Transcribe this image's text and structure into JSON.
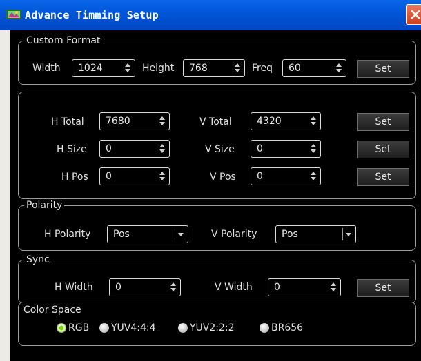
{
  "window": {
    "title": "Advance Timming Setup",
    "colors": {
      "titlebar": "#0055d6",
      "panel_bg": "#000000",
      "text": "#e0e0e0",
      "close": "#d9532c"
    }
  },
  "custom_format": {
    "legend": "Custom Format",
    "width_label": "Width",
    "width_value": "1024",
    "height_label": "Height",
    "height_value": "768",
    "freq_label": "Freq",
    "freq_value": "60",
    "set_label": "Set"
  },
  "totals": {
    "h_total_label": "H Total",
    "h_total_value": "7680",
    "v_total_label": "V Total",
    "v_total_value": "4320",
    "h_size_label": "H Size",
    "h_size_value": "0",
    "v_size_label": "V Size",
    "v_size_value": "0",
    "h_pos_label": "H Pos",
    "h_pos_value": "0",
    "v_pos_label": "V Pos",
    "v_pos_value": "0",
    "set_label": "Set"
  },
  "polarity": {
    "legend": "Polarity",
    "h_label": "H Polarity",
    "h_value": "Pos",
    "v_label": "V Polarity",
    "v_value": "Pos"
  },
  "sync": {
    "legend": "Sync",
    "h_width_label": "H Width",
    "h_width_value": "0",
    "v_width_label": "V Width",
    "v_width_value": "0",
    "set_label": "Set"
  },
  "color_space": {
    "legend": "Color Space",
    "options": [
      "RGB",
      "YUV4:4:4",
      "YUV2:2:2",
      "BR656"
    ],
    "selected": "RGB"
  }
}
